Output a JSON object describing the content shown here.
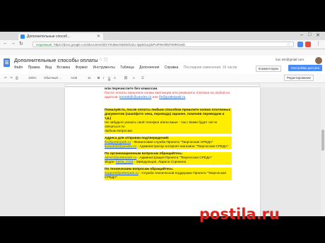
{
  "browser": {
    "tab_title": "Дополнительные способ…",
    "secure_label": "Надежный",
    "url": "https://docs.google.com/document/d/1Y9UBseX8Znkh1Zu-4ppkGoq1kPxiPWAhlM7WiRGedit",
    "window_controls": [
      "–",
      "□",
      "✕"
    ]
  },
  "docs": {
    "title": "Дополнительные способы оплаты",
    "menu": [
      "Файл",
      "Правка",
      "Вид",
      "Вставка",
      "Формат",
      "Инструменты",
      "Таблица",
      "Дополнения",
      "Справка"
    ],
    "saved_status": "Последние изменения: 16 часов",
    "user_email": "koc.mir@gmail.com",
    "comments_label": "Комментарии",
    "share_label": "Настройки доступа"
  },
  "toolbar": {
    "zoom": "100%",
    "style": "Обычный ...",
    "font": "Arial",
    "size": "11",
    "bold": "B",
    "italic": "I",
    "underline": "U",
    "color": "A",
    "editing": "Редактирование"
  },
  "document": {
    "line1": "или перечислите без комиссии.",
    "red1": "После оплаты пришлите копию квитанции или реквизиты платежа на любой из",
    "red2_prefix": "адресов:",
    "red2_email": "korsob@@yandex.ru",
    "red2_mid": "или",
    "red2_email2": "fin@potterpark.ru",
    "notice1": "Пожалуйста, после оплаты любым способом пришлите копию платежных",
    "notice2": "документов (скан/фото чека, перевода) заранее, поменяв переводом и т.д.)",
    "notice3": "Не забудьте указать свой телефон и/или ваше - так с Вами будет легче связаться по",
    "notice4": "любым вопросам.",
    "addr_head": "Адреса для отправки подтверждений:",
    "addr1_email": "fin@potterpark.ru",
    "addr1_text": " - Финансовая служба Проекта \"Творческая СРЕДА\"",
    "addr2_email": "korsob@@yandex.ru",
    "addr2_text": " - Администратор интернет-магазина \"Творческая СРЕДА\"",
    "org_head": "По организационным вопросам обращайтесь:",
    "org1_email": "admin@potterpark.ru",
    "org1_text": " - Администрация Проекта \"Творческая СРЕДА\"",
    "org2_prefix": "Skype:",
    "org2_skype": "larisa_2115",
    "org2_text": " - Заведующая, Лариса Сорокина",
    "tech_head": "По техническим вопросам обращайтесь:",
    "tech1_email": "support@potterpark.ru",
    "tech1_text": " - Служба технической поддержки Проекта \"Творческая",
    "tech2": "СРЕДА\""
  },
  "watermark": "postila.ru"
}
